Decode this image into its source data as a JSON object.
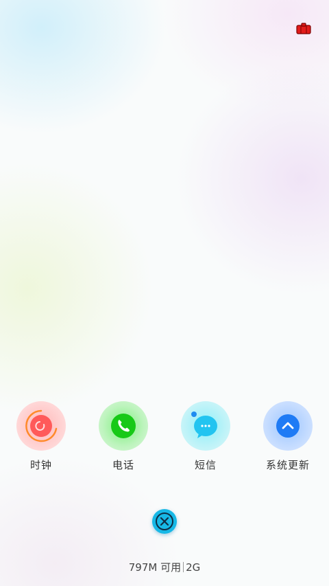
{
  "status": {
    "icon": "recent-apps-icon"
  },
  "apps": [
    {
      "label": "时钟",
      "icon": "clock-icon",
      "color": "#ff4d4d"
    },
    {
      "label": "电话",
      "icon": "phone-icon",
      "color": "#1ec91e"
    },
    {
      "label": "短信",
      "icon": "message-icon",
      "color": "#22c4f0"
    },
    {
      "label": "系统更新",
      "icon": "system-update-icon",
      "color": "#1f7bf5"
    }
  ],
  "footer": {
    "memory": "797M 可用",
    "total": "2G"
  },
  "close": {
    "icon": "close-icon"
  }
}
